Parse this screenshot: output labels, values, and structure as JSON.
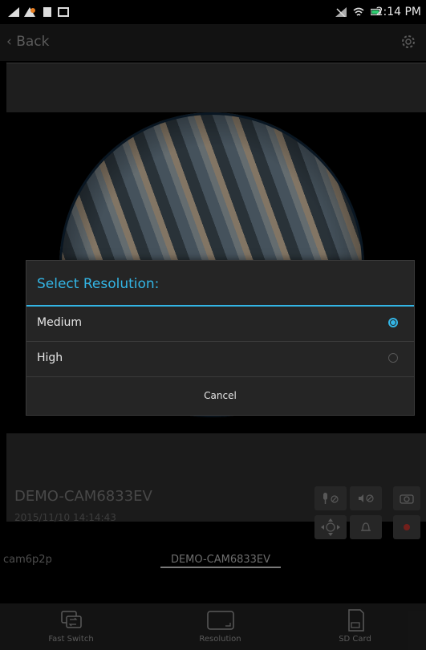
{
  "status_bar": {
    "time": "2:14 PM"
  },
  "nav": {
    "back_label": "Back"
  },
  "camera": {
    "name": "DEMO-CAM6833EV",
    "timestamp": "2015/11/10 14:14:43"
  },
  "camera_tabs": [
    {
      "label": "cam6p2p",
      "active": false
    },
    {
      "label": "DEMO-CAM6833EV",
      "active": true
    }
  ],
  "toolbar": {
    "fast_switch": "Fast Switch",
    "resolution": "Resolution",
    "sd_card": "SD Card"
  },
  "dialog": {
    "title": "Select Resolution:",
    "options": [
      {
        "label": "Medium",
        "selected": true
      },
      {
        "label": "High",
        "selected": false
      }
    ],
    "cancel_label": "Cancel"
  },
  "colors": {
    "accent": "#33b5e5",
    "record": "#c0392b"
  }
}
